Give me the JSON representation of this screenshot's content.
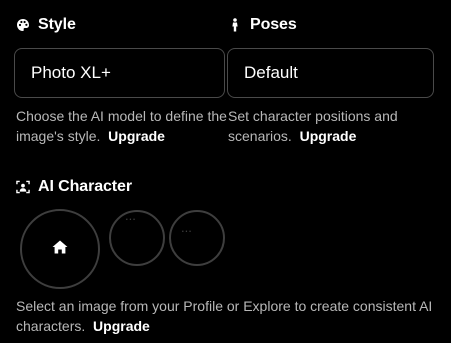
{
  "style_section": {
    "title": "Style",
    "icon": "palette-icon",
    "selected_model": "Photo XL+",
    "description": "Choose the AI model to define the image's style.",
    "upgrade_label": "Upgrade"
  },
  "poses_section": {
    "title": "Poses",
    "icon": "person-icon",
    "selected_pose": "Default",
    "description": "Set character positions and scenarios.",
    "upgrade_label": "Upgrade"
  },
  "character_section": {
    "title": "AI Character",
    "icon": "portrait-icon",
    "home_icon": "home-icon",
    "description": "Select an image from your Profile or Explore to create consistent AI characters.",
    "upgrade_label": "Upgrade"
  },
  "colors": {
    "background": "#000000",
    "border": "#4a4a4a",
    "muted_text": "#b8b8b8",
    "text": "#ffffff"
  }
}
